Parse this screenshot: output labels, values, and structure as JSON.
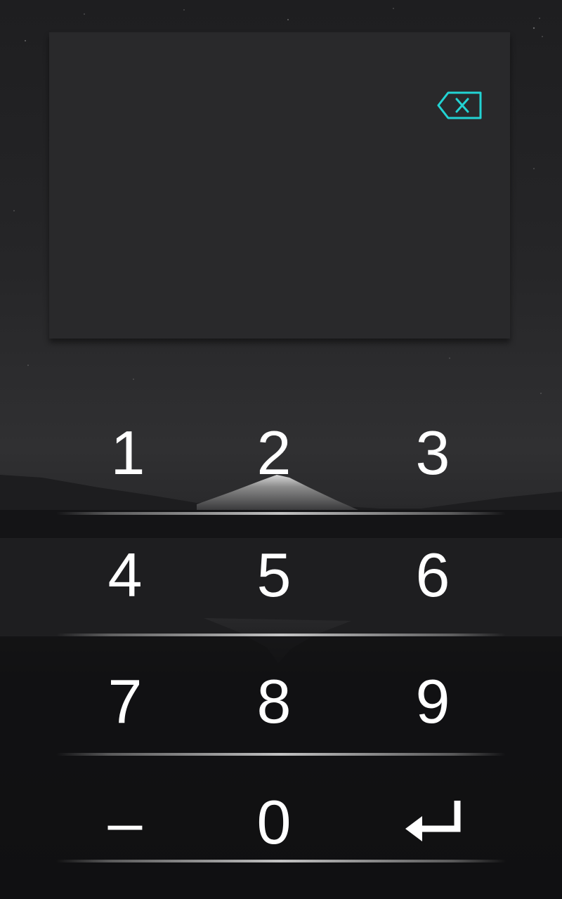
{
  "pin_pad": {
    "entered_value": "",
    "accent_color": "#22d3d3",
    "backspace_icon": "backspace-icon",
    "keys": {
      "k1": "1",
      "k2": "2",
      "k3": "3",
      "k4": "4",
      "k5": "5",
      "k6": "6",
      "k7": "7",
      "k8": "8",
      "k9": "9",
      "minus": "–",
      "k0": "0"
    },
    "enter_icon": "enter-arrow-icon"
  }
}
